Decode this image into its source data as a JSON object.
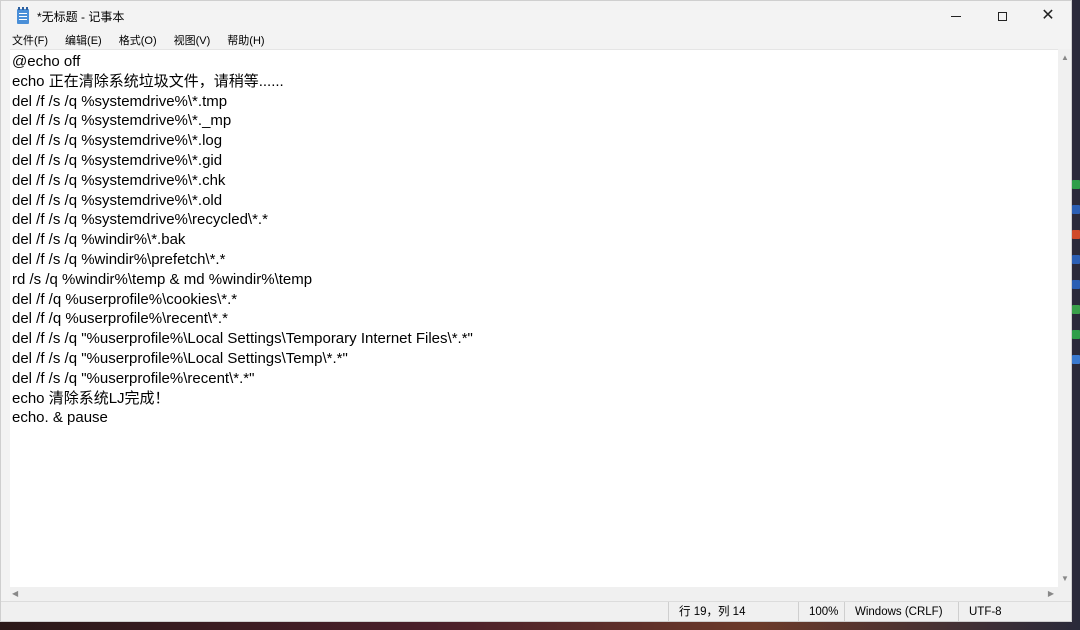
{
  "window": {
    "title": "*无标题 - 记事本",
    "icon": "notepad-icon",
    "controls": [
      "minimize-icon",
      "maximize-icon",
      "close-icon"
    ],
    "close_glyph": "✕"
  },
  "menu": [
    "文件(F)",
    "编辑(E)",
    "格式(O)",
    "视图(V)",
    "帮助(H)"
  ],
  "editor": {
    "content": "@echo off\necho 正在清除系统垃圾文件，请稍等......\ndel /f /s /q %systemdrive%\\*.tmp\ndel /f /s /q %systemdrive%\\*._mp\ndel /f /s /q %systemdrive%\\*.log\ndel /f /s /q %systemdrive%\\*.gid\ndel /f /s /q %systemdrive%\\*.chk\ndel /f /s /q %systemdrive%\\*.old\ndel /f /s /q %systemdrive%\\recycled\\*.*\ndel /f /s /q %windir%\\*.bak\ndel /f /s /q %windir%\\prefetch\\*.*\nrd /s /q %windir%\\temp & md %windir%\\temp\ndel /f /q %userprofile%\\cookies\\*.*\ndel /f /q %userprofile%\\recent\\*.*\ndel /f /s /q \"%userprofile%\\Local Settings\\Temporary Internet Files\\*.*\"\ndel /f /s /q \"%userprofile%\\Local Settings\\Temp\\*.*\"\ndel /f /s /q \"%userprofile%\\recent\\*.*\"\necho 清除系统LJ完成！\necho. & pause"
  },
  "scrollbars": {
    "up_arrow": "▲",
    "down_arrow": "▼",
    "left_arrow": "◀",
    "right_arrow": "▶"
  },
  "status": {
    "position": "行 19，列 14",
    "zoom": "100%",
    "line_ending": "Windows (CRLF)",
    "encoding": "UTF-8"
  },
  "colors": {
    "desktop_icons": [
      "#2e9e4a",
      "#2b5fb4",
      "#d04a2a",
      "#2b5fb4",
      "#2b5fb4",
      "#3aa04a",
      "#2e9e4a",
      "#3a7ad0"
    ]
  }
}
